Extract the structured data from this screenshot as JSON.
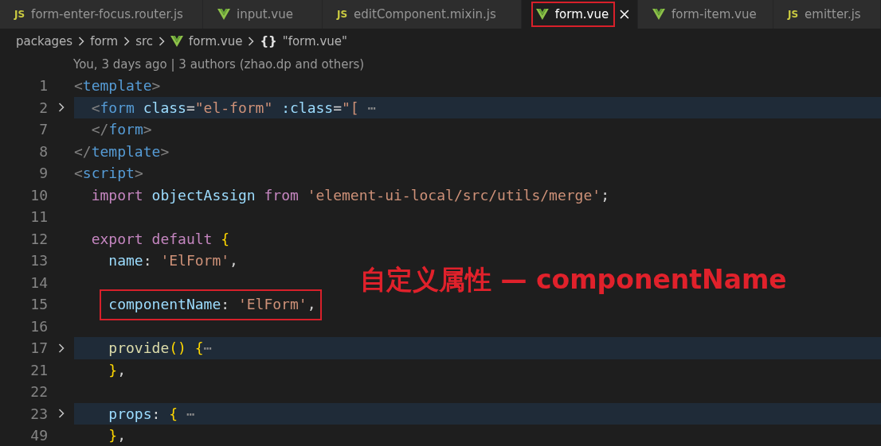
{
  "tabs": [
    {
      "label": "form-enter-focus.router.js",
      "kind": "js",
      "badge": "JS",
      "selected": false,
      "outlined": false
    },
    {
      "label": "input.vue",
      "kind": "vue",
      "selected": false,
      "outlined": false
    },
    {
      "label": "editComponent.mixin.js",
      "kind": "js",
      "badge": "JS",
      "selected": false,
      "outlined": false
    },
    {
      "label": "form.vue",
      "kind": "vue",
      "selected": true,
      "outlined": true
    },
    {
      "label": "form-item.vue",
      "kind": "vue",
      "selected": false,
      "outlined": false
    },
    {
      "label": "emitter.js",
      "kind": "js",
      "badge": "JS",
      "selected": false,
      "outlined": false
    }
  ],
  "breadcrumb": [
    {
      "kind": "folder",
      "label": "packages"
    },
    {
      "kind": "folder",
      "label": "form"
    },
    {
      "kind": "folder",
      "label": "src"
    },
    {
      "kind": "vue",
      "label": "form.vue"
    },
    {
      "kind": "symbol",
      "glyph": "{}",
      "label": "\"form.vue\""
    }
  ],
  "codelens": "You, 3 days ago | 3 authors (zhao.dp and others)",
  "lines": [
    {
      "number": "1",
      "folded": false,
      "outlined": false,
      "text": "<template>"
    },
    {
      "number": "2",
      "folded": true,
      "outlined": false,
      "text": "  <form class=\"el-form\" :class=\"[ ⋯"
    },
    {
      "number": "7",
      "folded": false,
      "outlined": false,
      "text": "  </form>"
    },
    {
      "number": "8",
      "folded": false,
      "outlined": false,
      "text": "</template>"
    },
    {
      "number": "9",
      "folded": false,
      "outlined": false,
      "text": "<script>"
    },
    {
      "number": "10",
      "folded": false,
      "outlined": false,
      "text": "  import objectAssign from 'element-ui-local/src/utils/merge';"
    },
    {
      "number": "11",
      "folded": false,
      "outlined": false
    },
    {
      "number": "12",
      "folded": false,
      "outlined": false,
      "text": "  export default {"
    },
    {
      "number": "13",
      "folded": false,
      "outlined": false,
      "text": "    name: 'ElForm',"
    },
    {
      "number": "14",
      "folded": false,
      "outlined": false
    },
    {
      "number": "15",
      "folded": false,
      "outlined": true,
      "text": "    componentName: 'ElForm',"
    },
    {
      "number": "16",
      "folded": false,
      "outlined": false
    },
    {
      "number": "17",
      "folded": true,
      "outlined": false,
      "text": "    provide() {⋯"
    },
    {
      "number": "21",
      "folded": false,
      "outlined": false,
      "text": "    },"
    },
    {
      "number": "22",
      "folded": false,
      "outlined": false
    },
    {
      "number": "23",
      "folded": true,
      "outlined": false,
      "text": "    props: { ⋯"
    },
    {
      "number": "49",
      "folded": false,
      "outlined": false,
      "text": "    },"
    }
  ],
  "annotation": "自定义属性 — componentName"
}
